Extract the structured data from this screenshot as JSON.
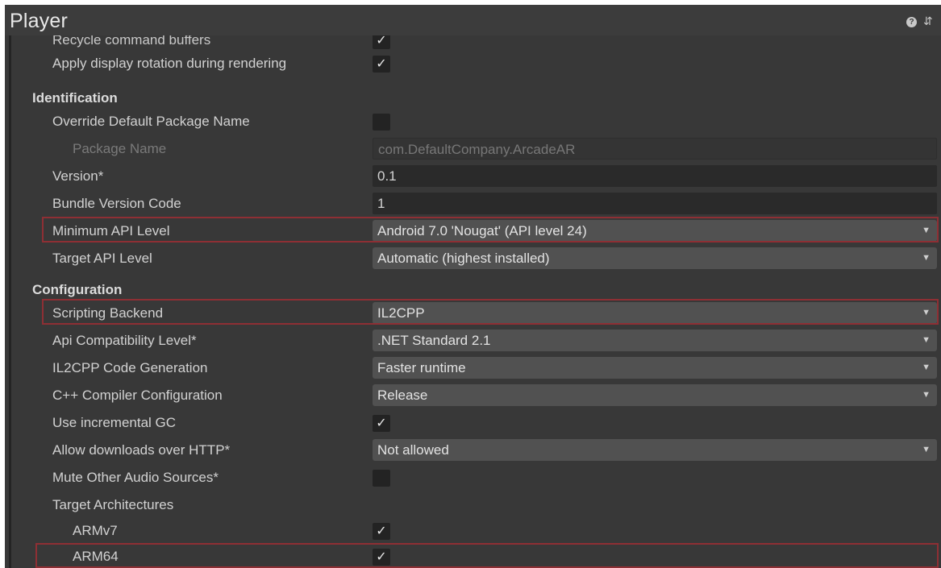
{
  "window": {
    "title": "Player",
    "icons": [
      "help-icon",
      "settings-sliders-icon"
    ]
  },
  "rows_top": [
    {
      "label": "Recycle command buffers",
      "checked": "✓"
    },
    {
      "label": "Apply display rotation during rendering",
      "checked": "✓"
    }
  ],
  "identification": {
    "header": "Identification",
    "override_label": "Override Default Package Name",
    "package_name_label": "Package Name",
    "package_name_value": "com.DefaultCompany.ArcadeAR",
    "version_label": "Version*",
    "version_value": "0.1",
    "bundle_label": "Bundle Version Code",
    "bundle_value": "1",
    "min_api_label": "Minimum API Level",
    "min_api_value": "Android 7.0 'Nougat' (API level 24)",
    "target_api_label": "Target API Level",
    "target_api_value": "Automatic (highest installed)"
  },
  "configuration": {
    "header": "Configuration",
    "scripting_label": "Scripting Backend",
    "scripting_value": "IL2CPP",
    "api_compat_label": "Api Compatibility Level*",
    "api_compat_value": ".NET Standard 2.1",
    "il2cpp_gen_label": "IL2CPP Code Generation",
    "il2cpp_gen_value": "Faster runtime",
    "cpp_config_label": "C++ Compiler Configuration",
    "cpp_config_value": "Release",
    "incremental_gc_label": "Use incremental GC",
    "incremental_gc_check": "✓",
    "http_label": "Allow downloads over HTTP*",
    "http_value": "Not allowed",
    "mute_label": "Mute Other Audio Sources*",
    "target_arch_label": "Target Architectures",
    "armv7_label": "ARMv7",
    "armv7_check": "✓",
    "arm64_label": "ARM64",
    "arm64_check": "✓"
  },
  "colors": {
    "panel_bg": "#383838",
    "highlight": "#8e2f34",
    "dropdown_bg": "#515151",
    "field_bg": "#2a2a2a"
  }
}
